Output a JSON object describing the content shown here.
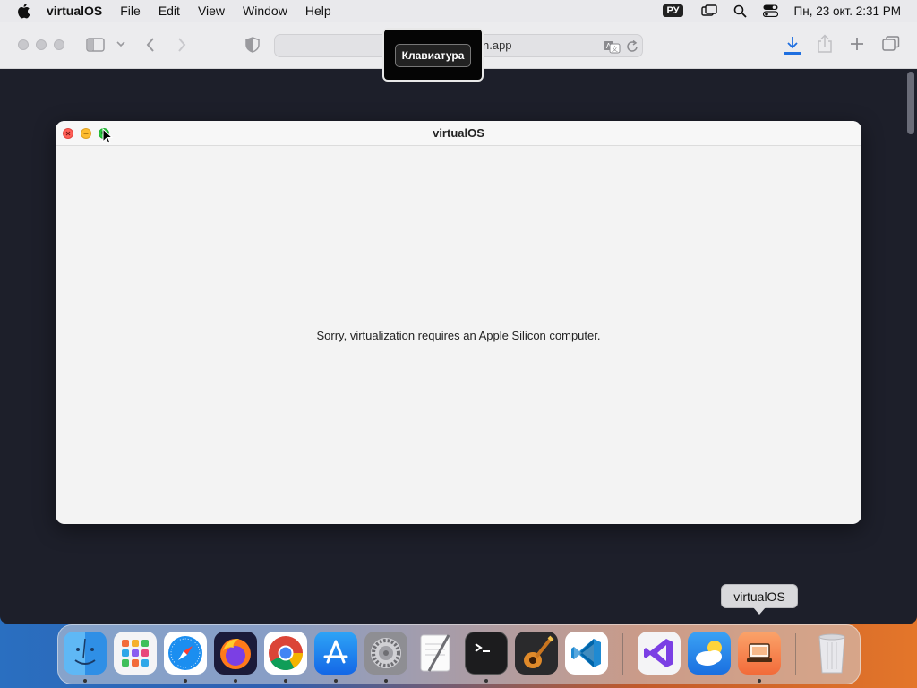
{
  "menubar": {
    "app_name": "virtualOS",
    "items": [
      "File",
      "Edit",
      "View",
      "Window",
      "Help"
    ],
    "keyboard_layout": "РУ",
    "clock": "Пн, 23 окт.  2:31 PM"
  },
  "browser": {
    "address": "n.app",
    "keyboard_popup": "Клавиатура"
  },
  "app_window": {
    "title": "virtualOS",
    "message": "Sorry, virtualization requires an Apple Silicon computer."
  },
  "dock": {
    "tooltip": "virtualOS",
    "apps": [
      "Finder",
      "Launchpad",
      "Safari",
      "Firefox",
      "Chrome",
      "App Store",
      "System Settings",
      "TextEdit",
      "Terminal",
      "GarageBand",
      "Visual Studio Code",
      "Visual Studio",
      "Weather",
      "virtualOS",
      "Trash"
    ]
  },
  "colors": {
    "accent": "#1e6fe0",
    "close": "#ff5f57",
    "minimize": "#febc2e",
    "zoom": "#28c840"
  }
}
